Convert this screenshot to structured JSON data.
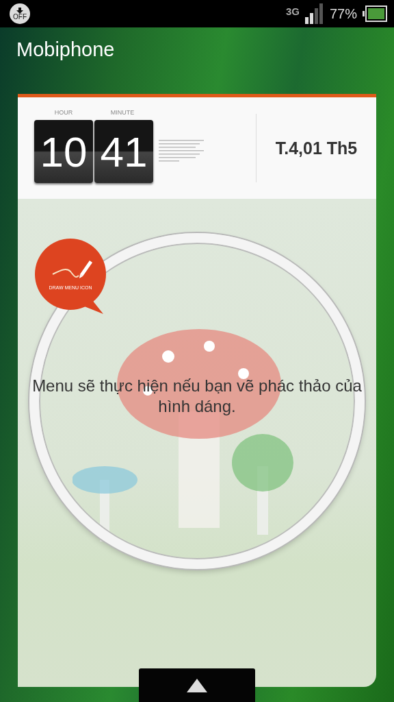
{
  "status_bar": {
    "usb_label": "OFF",
    "network": "3G",
    "battery": "77%"
  },
  "app_title": "Mobiphone",
  "clock": {
    "hour_label": "HOUR",
    "minute_label": "MINUTE",
    "hour": "10",
    "minute": "41",
    "date": "T.4,01 Th5"
  },
  "draw_badge": {
    "label": "DRAW MENU ICON"
  },
  "message": "Menu sẽ thực hiện nếu bạn vẽ phác thảo của hình dáng."
}
